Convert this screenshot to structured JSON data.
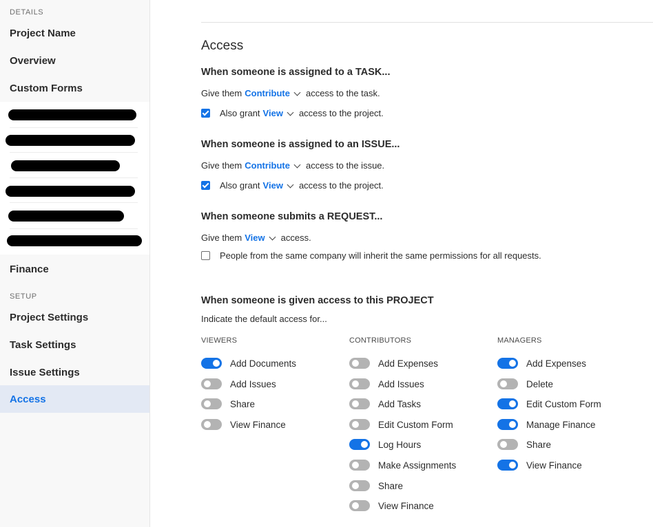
{
  "sidebar": {
    "details_label": "DETAILS",
    "setup_label": "SETUP",
    "details_items": [
      "Project Name",
      "Overview",
      "Custom Forms"
    ],
    "finance_label": "Finance",
    "setup_items": [
      "Project Settings",
      "Task Settings",
      "Issue Settings",
      "Access"
    ],
    "active_item": "Access"
  },
  "main": {
    "title": "Access",
    "task": {
      "heading": "When someone is assigned to a TASK...",
      "give_prefix": "Give them",
      "give_level": "Contribute",
      "give_suffix": "access to the task.",
      "also_prefix": "Also grant",
      "also_level": "View",
      "also_suffix": "access to the project.",
      "also_checked": true
    },
    "issue": {
      "heading": "When someone is assigned to an ISSUE...",
      "give_prefix": "Give them",
      "give_level": "Contribute",
      "give_suffix": "access to the issue.",
      "also_prefix": "Also grant",
      "also_level": "View",
      "also_suffix": "access to the project.",
      "also_checked": true
    },
    "request": {
      "heading": "When someone submits a REQUEST...",
      "give_prefix": "Give them",
      "give_level": "View",
      "give_suffix": "access.",
      "inherit_label": "People from the same company will inherit the same permissions for all requests.",
      "inherit_checked": false
    },
    "project": {
      "heading": "When someone is given access to this PROJECT",
      "subheading": "Indicate the default access for...",
      "columns": [
        {
          "label": "VIEWERS",
          "items": [
            {
              "label": "Add Documents",
              "on": true
            },
            {
              "label": "Add Issues",
              "on": false
            },
            {
              "label": "Share",
              "on": false
            },
            {
              "label": "View Finance",
              "on": false
            }
          ]
        },
        {
          "label": "CONTRIBUTORS",
          "items": [
            {
              "label": "Add Expenses",
              "on": false
            },
            {
              "label": "Add Issues",
              "on": false
            },
            {
              "label": "Add Tasks",
              "on": false
            },
            {
              "label": "Edit Custom Form",
              "on": false
            },
            {
              "label": "Log Hours",
              "on": true
            },
            {
              "label": "Make Assignments",
              "on": false
            },
            {
              "label": "Share",
              "on": false
            },
            {
              "label": "View Finance",
              "on": false
            }
          ]
        },
        {
          "label": "MANAGERS",
          "items": [
            {
              "label": "Add Expenses",
              "on": true
            },
            {
              "label": "Delete",
              "on": false
            },
            {
              "label": "Edit Custom Form",
              "on": true
            },
            {
              "label": "Manage Finance",
              "on": true
            },
            {
              "label": "Share",
              "on": false
            },
            {
              "label": "View Finance",
              "on": true
            }
          ]
        }
      ]
    }
  },
  "colors": {
    "accent": "#1473e6",
    "toggle_off": "#b3b3b3",
    "active_nav_bg": "#e3e9f4"
  }
}
